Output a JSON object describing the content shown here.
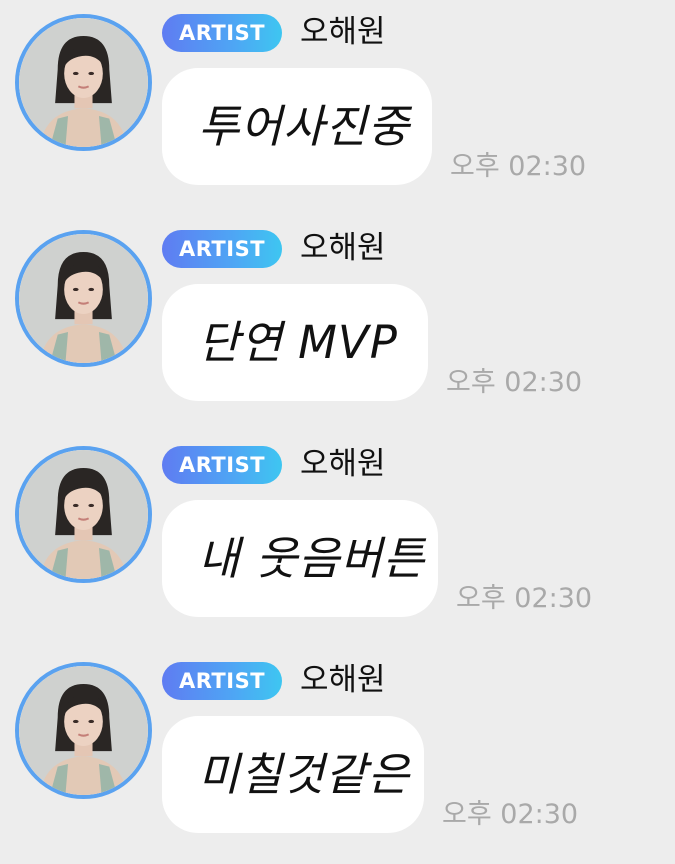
{
  "messages": [
    {
      "badge": "ARTIST",
      "sender": "오해원",
      "text": "투어사진중",
      "time": "오후 02:30"
    },
    {
      "badge": "ARTIST",
      "sender": "오해원",
      "text": "단연 MVP",
      "time": "오후 02:30"
    },
    {
      "badge": "ARTIST",
      "sender": "오해원",
      "text": "내 웃음버튼",
      "time": "오후 02:30"
    },
    {
      "badge": "ARTIST",
      "sender": "오해원",
      "text": "미칠것같은",
      "time": "오후 02:30"
    }
  ],
  "colors": {
    "background": "#ededed",
    "bubble": "#ffffff",
    "avatar_ring": "#5aa2f0",
    "badge_gradient_start": "#5f7cf2",
    "badge_gradient_end": "#3ec6f1",
    "time_text": "#a9a9a9"
  },
  "icons": {
    "avatar": "profile-photo"
  }
}
